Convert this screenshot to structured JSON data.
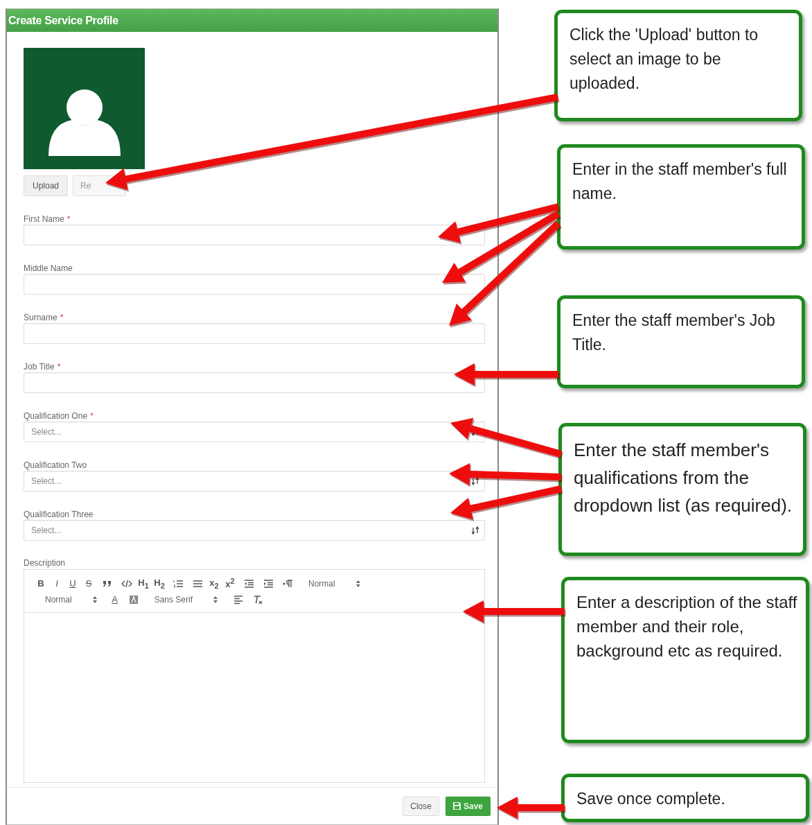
{
  "dialog": {
    "title": "Create Service Profile",
    "photo_buttons": [
      {
        "label": "Upload",
        "kind": "normal"
      },
      {
        "label": "Re",
        "kind": "faded"
      }
    ],
    "fields": [
      {
        "label": "First Name",
        "required_mark": "*",
        "kind": "text"
      },
      {
        "label": "Middle Name",
        "kind": "text"
      },
      {
        "label": "Surname",
        "required_mark": "*",
        "kind": "text"
      },
      {
        "label": "Job Title",
        "required_mark": "*",
        "kind": "text"
      },
      {
        "label": "Qualification One",
        "required_mark": "*",
        "kind": "select",
        "placeholder": "Select..."
      },
      {
        "label": "Qualification Two",
        "kind": "select",
        "placeholder": "Select..."
      },
      {
        "label": "Qualification Three",
        "kind": "select",
        "placeholder": "Select..."
      }
    ],
    "description": {
      "label": "Description",
      "toolbar": [
        [
          {
            "kind": "glyph",
            "label": "B"
          },
          {
            "kind": "glyph",
            "label": "I"
          },
          {
            "kind": "glyph",
            "label": "U"
          },
          {
            "kind": "glyph",
            "label": "S"
          },
          {
            "kind": "icon"
          },
          {
            "kind": "icon"
          },
          {
            "kind": "glyph",
            "label": "H$_{1}$"
          },
          {
            "kind": "glyph",
            "label": "H$_{2}$"
          },
          {
            "kind": "icon"
          },
          {
            "kind": "icon"
          },
          {
            "kind": "glyph",
            "label": "x$_{2}$"
          },
          {
            "kind": "glyph",
            "label": "x$^{2}$"
          },
          {
            "kind": "icon"
          },
          {
            "kind": "icon"
          },
          {
            "kind": "icon"
          },
          {
            "kind": "picker",
            "label": "Normal"
          }
        ],
        [
          {
            "kind": "picker",
            "label": "Normal"
          },
          {
            "kind": "glyph",
            "label": "A"
          },
          {
            "kind": "icon"
          },
          {
            "kind": "picker",
            "label": "Sans Serif"
          },
          {
            "kind": "icon"
          },
          {
            "kind": "icon"
          }
        ]
      ]
    },
    "footer_buttons": [
      {
        "label": "Close",
        "kind": "default"
      },
      {
        "label": "Save",
        "kind": "primary"
      }
    ]
  },
  "callouts": [
    {
      "text": "Click the 'Upload' button to select an image to be uploaded."
    },
    {
      "text": "Enter in the staff member's full name."
    },
    {
      "text": "Enter the staff member's Job Title."
    },
    {
      "text": "Enter the staff member's qualifications from the dropdown list (as required)."
    },
    {
      "text": "Enter a description of the staff member and their role, background etc as required."
    },
    {
      "text": "Save once complete."
    }
  ]
}
